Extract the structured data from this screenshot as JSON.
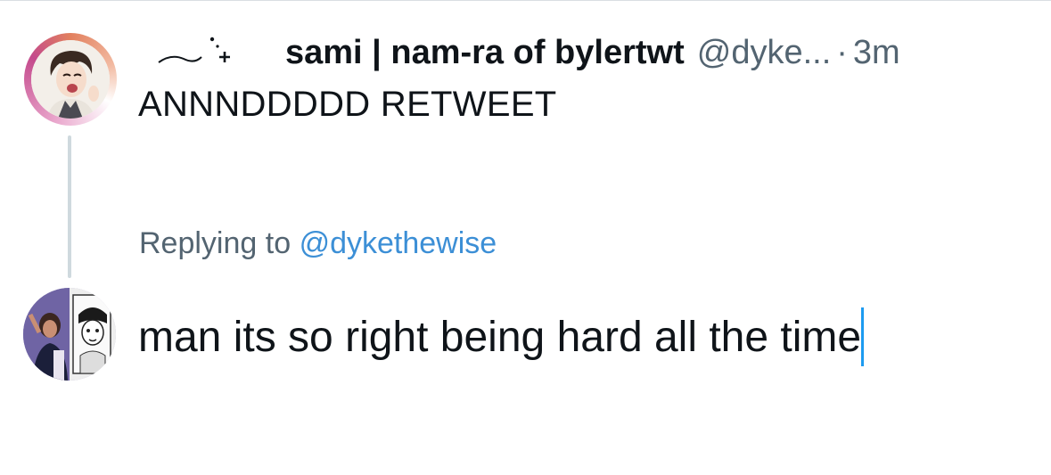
{
  "original_tweet": {
    "author_display_name": "sami | nam-ra of bylertwt",
    "author_handle": "@dyke...",
    "separator": "·",
    "timestamp": "3m",
    "text": "ANNNDDDDD RETWEET",
    "avatar_icon": "profile-avatar-illustration",
    "name_decoration_icon": "sparkle-swirl-icon"
  },
  "reply": {
    "replying_to_label": "Replying to",
    "replying_to_handle": "@dykethewise",
    "draft_text": "man its so right being hard all the time",
    "avatar_icon": "profile-avatar-photo-collage"
  },
  "colors": {
    "primary_text": "#0f1419",
    "secondary_text": "#536471",
    "link": "#3c8fd6",
    "caret": "#1d9bf0",
    "thread_line": "#cfd9de"
  }
}
